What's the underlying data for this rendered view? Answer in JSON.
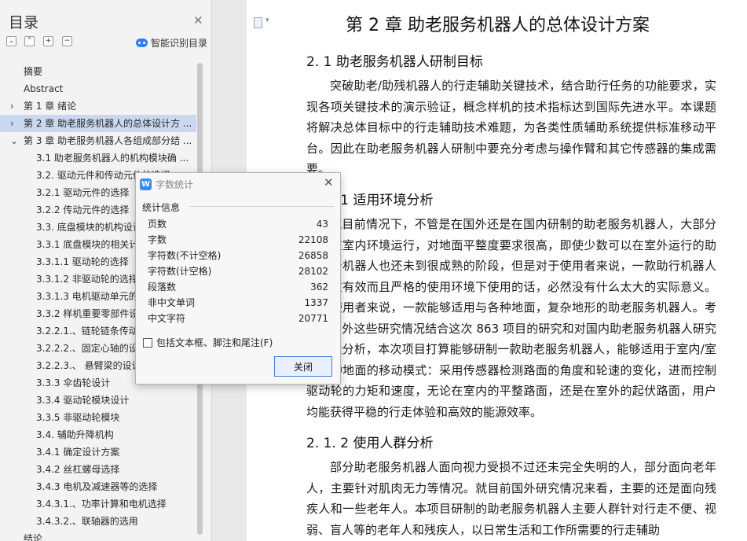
{
  "outline": {
    "title": "目录",
    "smart_label": "智能识别目录",
    "items": [
      {
        "label": "摘要",
        "level": 1,
        "arrow": ""
      },
      {
        "label": "Abstract",
        "level": 1,
        "arrow": ""
      },
      {
        "label": "第 1 章  绪论",
        "level": 1,
        "arrow": "right"
      },
      {
        "label": "第 2 章  助老服务机器人的总体设计方 ...",
        "level": 1,
        "arrow": "right",
        "selected": true
      },
      {
        "label": "第 3 章  助老服务机器人各组成部分结 ...",
        "level": 1,
        "arrow": "down"
      },
      {
        "label": "3.1 助老服务机器人的机构模块确 ...",
        "level": 2,
        "arrow": ""
      },
      {
        "label": "3.2.  驱动元件和传动元件的选择",
        "level": 2,
        "arrow": ""
      },
      {
        "label": "3.2.1  驱动元件的选择",
        "level": 2,
        "arrow": ""
      },
      {
        "label": "3.2.2  传动元件的选择",
        "level": 2,
        "arrow": ""
      },
      {
        "label": "3.3.  底盘模块的机构设计",
        "level": 2,
        "arrow": ""
      },
      {
        "label": "3.3.1  底盘模块的相关计算",
        "level": 2,
        "arrow": ""
      },
      {
        "label": "3.3.1.1  驱动轮的选择",
        "level": 2,
        "arrow": ""
      },
      {
        "label": "3.3.1.2  非驱动轮的选择",
        "level": 2,
        "arrow": ""
      },
      {
        "label": "3.3.1.3  电机驱动单元的选择",
        "level": 2,
        "arrow": ""
      },
      {
        "label": "3.3.2  样机重要零部件设计",
        "level": 2,
        "arrow": ""
      },
      {
        "label": "3.2.2.1.、链轮链条传动",
        "level": 2,
        "arrow": ""
      },
      {
        "label": "3.2.2.2.、固定心轴的设计",
        "level": 2,
        "arrow": ""
      },
      {
        "label": "3.2.2.3.、 悬臂梁的设计",
        "level": 2,
        "arrow": ""
      },
      {
        "label": "3.3.3  伞齿轮设计",
        "level": 2,
        "arrow": ""
      },
      {
        "label": "3.3.4  驱动轮模块设计",
        "level": 2,
        "arrow": ""
      },
      {
        "label": "3.3.5  非驱动轮模块",
        "level": 2,
        "arrow": ""
      },
      {
        "label": "3.4.  辅助升降机构",
        "level": 2,
        "arrow": ""
      },
      {
        "label": "3.4.1  确定设计方案",
        "level": 2,
        "arrow": ""
      },
      {
        "label": "3.4.2  丝杠螺母选择",
        "level": 2,
        "arrow": ""
      },
      {
        "label": "3.4.3  电机及减速器等的选择",
        "level": 2,
        "arrow": ""
      },
      {
        "label": "3.4.3.1.、功率计算和电机选择",
        "level": 2,
        "arrow": ""
      },
      {
        "label": "3.4.3.2.、联轴器的选用",
        "level": 2,
        "arrow": ""
      },
      {
        "label": "结论",
        "level": 1,
        "arrow": ""
      }
    ]
  },
  "document": {
    "chapter_title": "第 2 章  助老服务机器人的总体设计方案",
    "section_title": "2. 1 助老服务机器人研制目标",
    "para1": "突破助老/助残机器人的行走辅助关键技术，结合助行任务的功能要求，实现各项关键技术的演示验证，概念样机的技术指标达到国际先进水平。本课题将解决总体目标中的行走辅助技术难题，为各类性质辅助系统提供标准移动平台。因此在助老服务机器人研制中要充分考虑与操作臂和其它传感器的集成需要。",
    "subsection1_title": "2. 1. 1 适用环境分析",
    "para2": "就目前情况下，不管是在国外还是在国内研制的助老服务机器人，大部分都是在室内环境运行，对地面平整度要求很高，即使少数可以在室外运行的助老服务机器人也还未到很成熟的阶段，但是对于使用者来说，一款助行机器人只能在有效而且严格的使用环境下使用的话，必然没有什么太大的实际意义。对于使用者来说，一款能够适用与各种地面，复杂地形的助老服务机器人。考虑国内外这些研究情况结合这次 863 项目的研究和对国内助老服务机器人研究的现状分析，本次项目打算能够研制一款助老服务机器人，能够适用于室内/室外多种地面的移动模式：采用传感器检测路面的角度和轮速的变化，进而控制驱动轮的力矩和速度，无论在室内的平整路面，还是在室外的起伏路面，用户均能获得平稳的行走体验和高效的能源效率。",
    "subsection2_title": "2. 1. 2 使用人群分析",
    "para3": "部分助老服务机器人面向视力受损不过还未完全失明的人，部分面向老年人，主要针对肌肉无力等情况。就目前国外研究情况来看，主要的还是面向残疾人和一些老年人。本项目研制的助老服务机器人主要人群针对行走不便、视弱、盲人等的老年人和残疾人，以日常生活和工作所需要的行走辅助"
  },
  "dialog": {
    "title": "字数统计",
    "section_label": "统计信息",
    "stats": [
      {
        "label": "页数",
        "value": "43"
      },
      {
        "label": "字数",
        "value": "22108"
      },
      {
        "label": "字符数(不计空格)",
        "value": "26858"
      },
      {
        "label": "字符数(计空格)",
        "value": "28102"
      },
      {
        "label": "段落数",
        "value": "362"
      },
      {
        "label": "非中文单词",
        "value": "1337"
      },
      {
        "label": "中文字符",
        "value": "20771"
      }
    ],
    "checkbox_label": "包括文本框、脚注和尾注(F)",
    "checkbox_checked": false,
    "close_button": "关闭"
  },
  "colors": {
    "selected_item_bg": "#c9d7ef",
    "accent_blue": "#3b82e6"
  }
}
